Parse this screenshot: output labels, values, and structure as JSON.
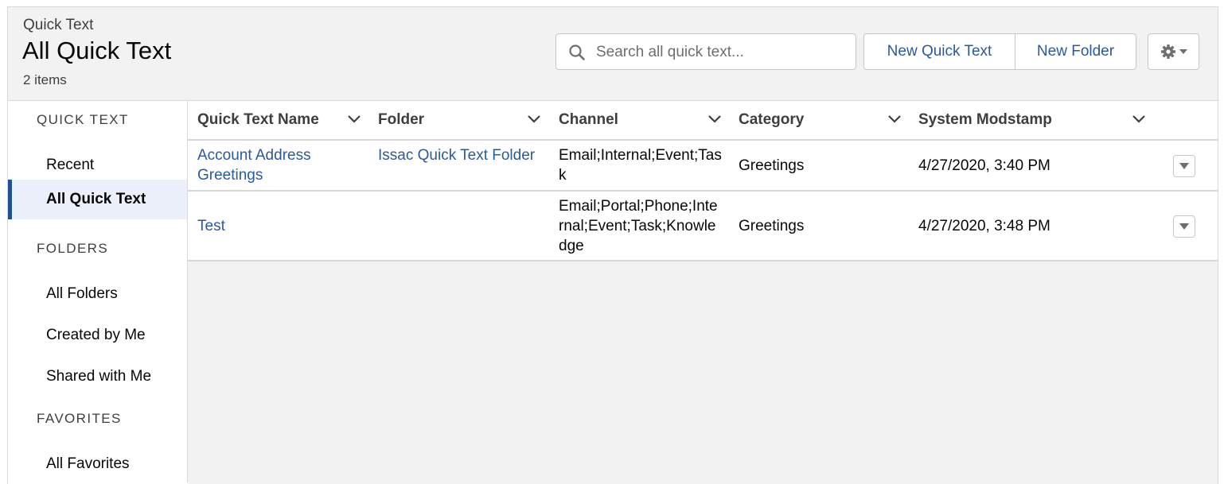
{
  "header": {
    "breadcrumb": "Quick Text",
    "title": "All Quick Text",
    "item_count": "2 items",
    "search_placeholder": "Search all quick text...",
    "new_quick_text_label": "New Quick Text",
    "new_folder_label": "New Folder"
  },
  "sidebar": {
    "quick_text_title": "QUICK TEXT",
    "recent": "Recent",
    "all_quick_text": "All Quick Text",
    "folders_title": "FOLDERS",
    "all_folders": "All Folders",
    "created_by_me": "Created by Me",
    "shared_with_me": "Shared with Me",
    "favorites_title": "FAVORITES",
    "all_favorites": "All Favorites"
  },
  "table": {
    "columns": [
      "Quick Text Name",
      "Folder",
      "Channel",
      "Category",
      "System Modstamp"
    ],
    "rows": [
      {
        "name": "Account Address Greetings",
        "folder": "Issac Quick Text Folder",
        "channel": "Email;Internal;Event;Task",
        "category": "Greetings",
        "modstamp": "4/27/2020, 3:40 PM"
      },
      {
        "name": "Test",
        "folder": "",
        "channel": "Email;Portal;Phone;Internal;Event;Task;Knowledge",
        "category": "Greetings",
        "modstamp": "4/27/2020, 3:48 PM"
      }
    ]
  },
  "colors": {
    "link": "#2a5a9e",
    "active_nav_bg": "#ebf0fa",
    "active_nav_border": "#1b5297",
    "header_bg": "#f3f2f2"
  }
}
